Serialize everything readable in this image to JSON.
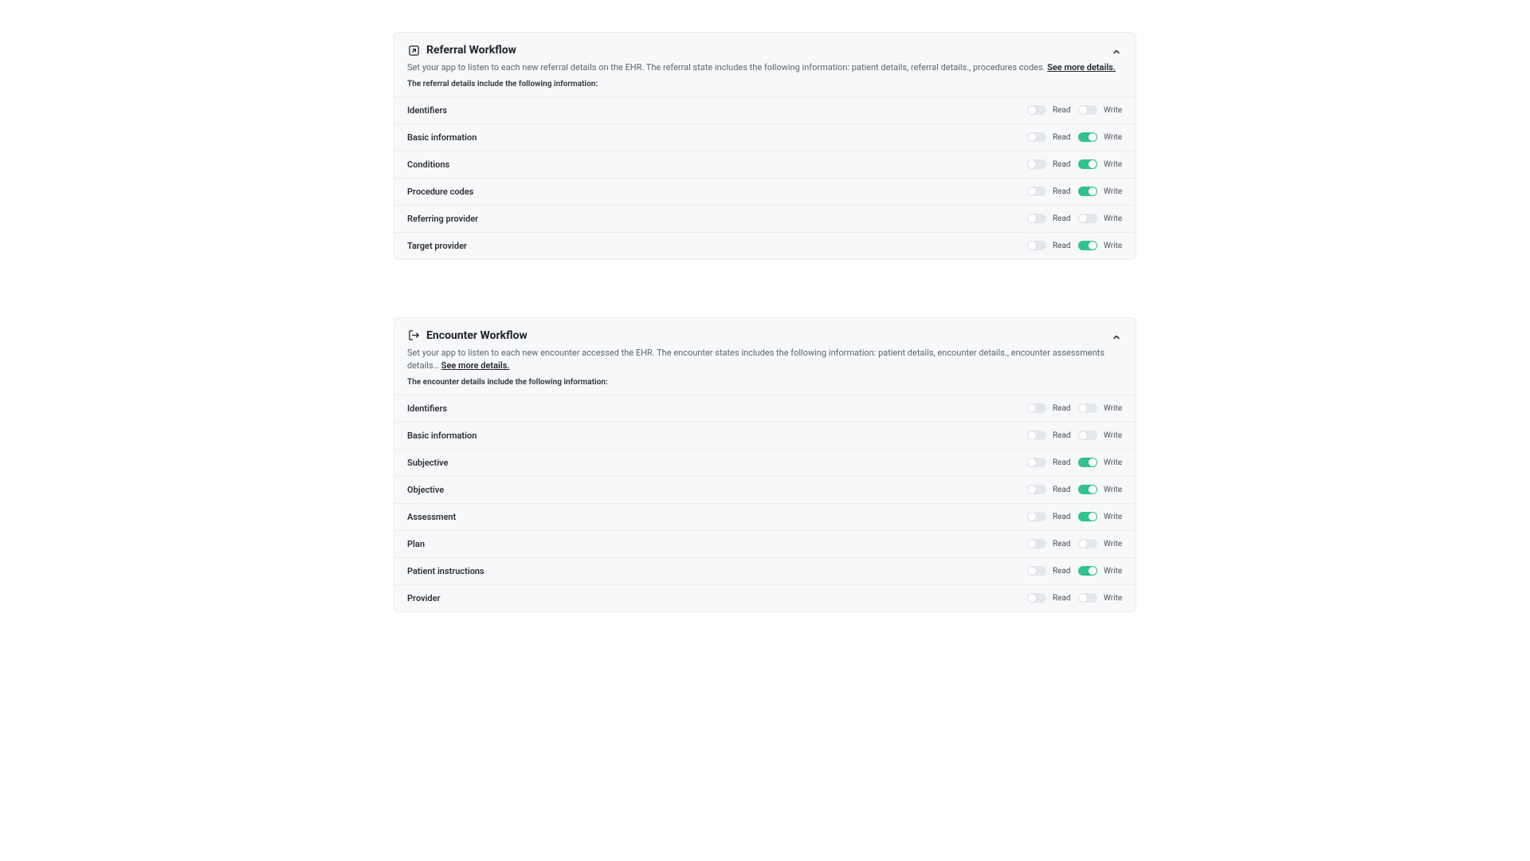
{
  "labels": {
    "read": "Read",
    "write": "Write"
  },
  "panels": [
    {
      "key": "referral",
      "title": "Referral Workflow",
      "description": "Set your app to listen to each new referral details on the EHR. The referral state includes the following information: patient details, referral details., procedures codes. ",
      "see_more": "See more details.",
      "sub": "The referral details include the following information:",
      "icon": "arrow-out",
      "rows": [
        {
          "label": "Identifiers",
          "read": false,
          "write": false
        },
        {
          "label": "Basic information",
          "read": false,
          "write": true
        },
        {
          "label": "Conditions",
          "read": false,
          "write": true
        },
        {
          "label": "Procedure codes",
          "read": false,
          "write": true
        },
        {
          "label": "Referring provider",
          "read": false,
          "write": false
        },
        {
          "label": "Target provider",
          "read": false,
          "write": true
        }
      ]
    },
    {
      "key": "encounter",
      "title": "Encounter Workflow",
      "description": "Set your app to listen to each new encounter accessed the EHR. The encounter states includes the following information: patient details, encounter details., encounter assessments details…  ",
      "see_more": "See more details.",
      "sub": "The encounter details include the following information:",
      "icon": "arrow-in",
      "rows": [
        {
          "label": "Identifiers",
          "read": false,
          "write": false
        },
        {
          "label": "Basic information",
          "read": false,
          "write": false
        },
        {
          "label": "Subjective",
          "read": false,
          "write": true
        },
        {
          "label": "Objective",
          "read": false,
          "write": true
        },
        {
          "label": "Assessment",
          "read": false,
          "write": true
        },
        {
          "label": "Plan",
          "read": false,
          "write": false
        },
        {
          "label": "Patient instructions",
          "read": false,
          "write": true
        },
        {
          "label": "Provider",
          "read": false,
          "write": false
        }
      ]
    }
  ]
}
